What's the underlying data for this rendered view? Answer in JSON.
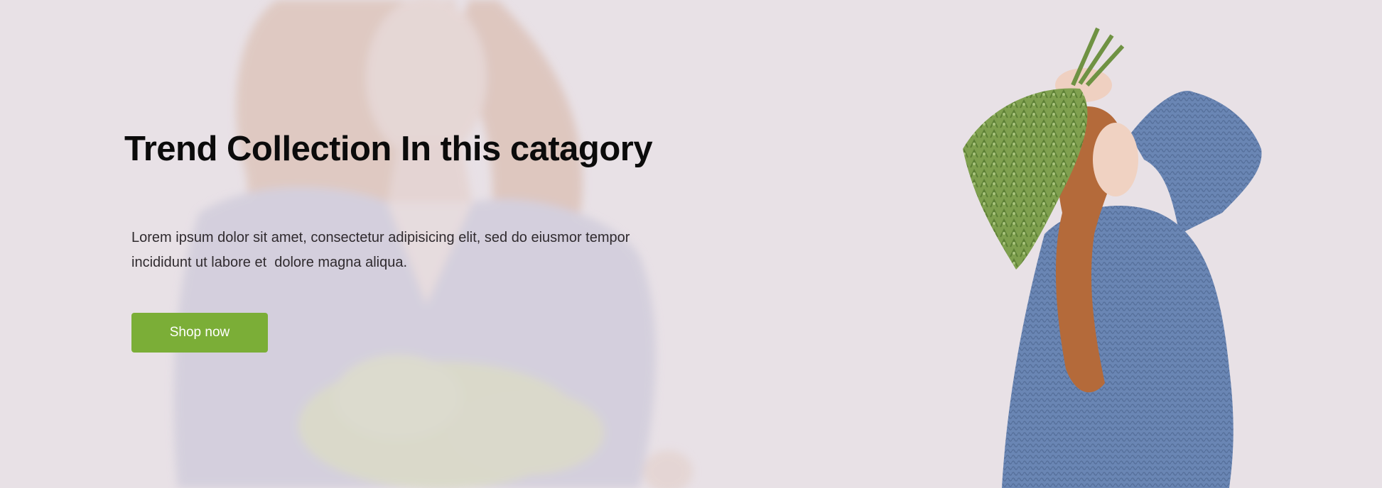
{
  "hero": {
    "title": "Trend Collection In this catagory",
    "description": "Lorem ipsum dolor sit amet, consectetur adipisicing elit, sed do eiusmor tempor\nincididunt ut labore et  dolore magna aliqua.",
    "button_label": "Shop now"
  },
  "colors": {
    "background": "#e8e1e6",
    "accent": "#7bae37",
    "title": "#0b0b0b",
    "body_text": "#2f2a2e"
  }
}
